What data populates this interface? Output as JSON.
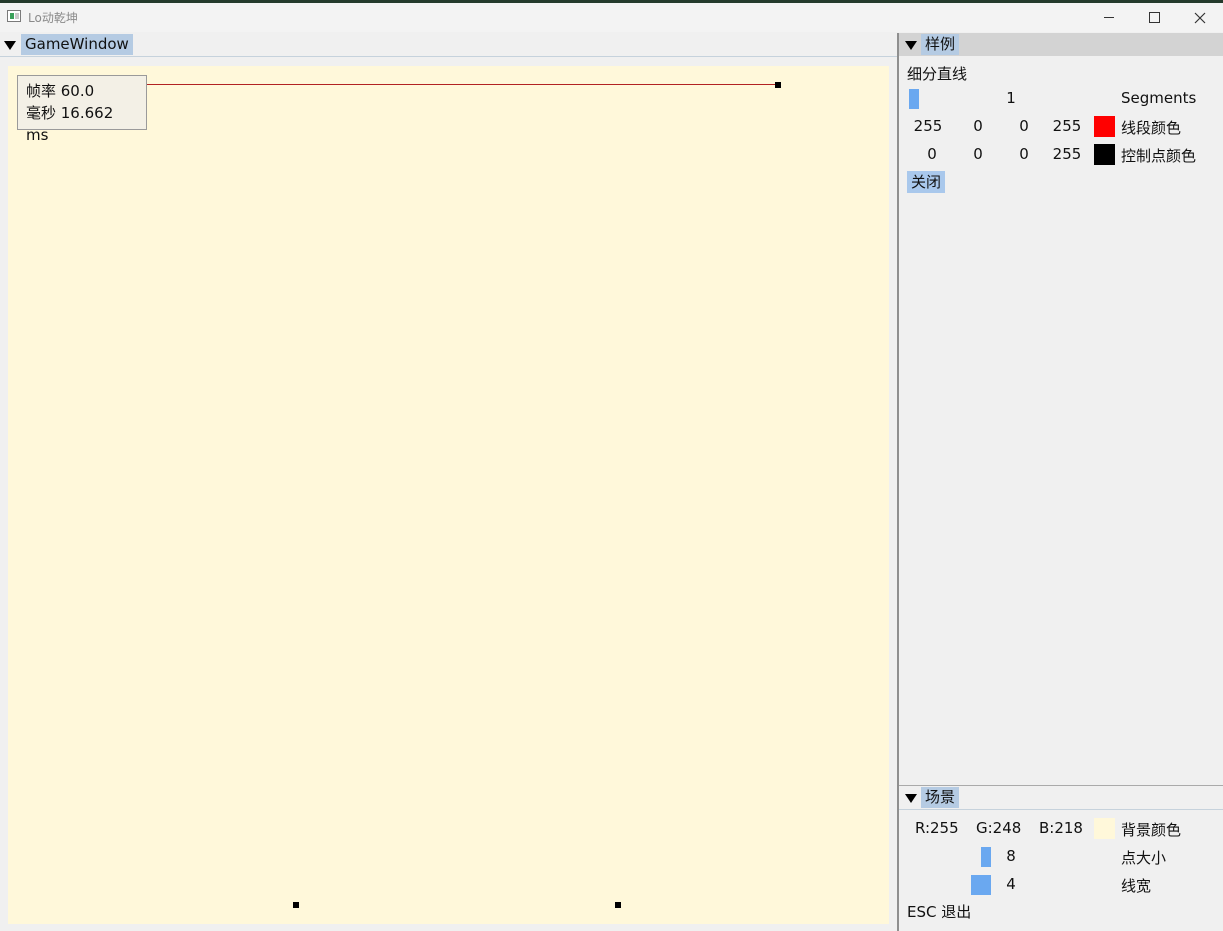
{
  "window": {
    "title": "Lo动乾坤"
  },
  "game_window": {
    "tab_label": "GameWindow",
    "fps_label": "帧率 60.0",
    "ms_label": "毫秒 16.662 ms"
  },
  "sample_panel": {
    "tab_label": "样例",
    "section_title": "细分直线",
    "segments": {
      "value": "1",
      "label": "Segments"
    },
    "segment_color": {
      "r": "255",
      "g": "0",
      "b": "0",
      "a": "255",
      "label": "线段颜色",
      "swatch": "#ff0000"
    },
    "control_point_color": {
      "r": "0",
      "g": "0",
      "b": "0",
      "a": "255",
      "label": "控制点颜色",
      "swatch": "#000000"
    },
    "close_button": "关闭"
  },
  "scene_panel": {
    "tab_label": "场景",
    "background": {
      "r": "R:255",
      "g": "G:248",
      "b": "B:218",
      "label": "背景颜色",
      "swatch": "#fff8da"
    },
    "point_size": {
      "value": "8",
      "label": "点大小"
    },
    "line_width": {
      "value": "4",
      "label": "线宽"
    },
    "exit_hint": "ESC 退出"
  }
}
